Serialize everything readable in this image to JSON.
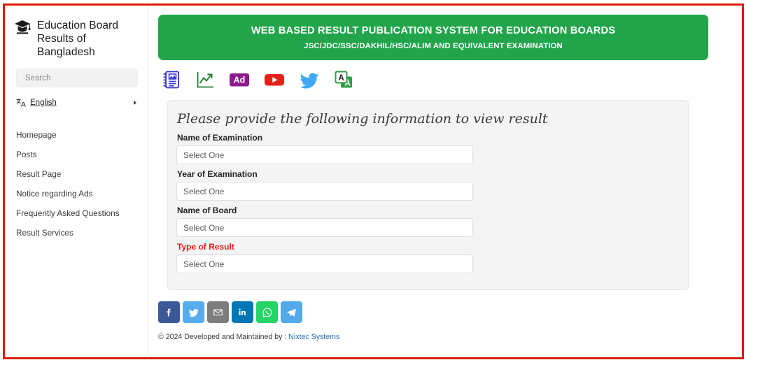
{
  "sidebar": {
    "logo_icon": "graduation-cap-icon",
    "title": "Education Board Results of Bangladesh",
    "search": {
      "placeholder": "Search",
      "value": "",
      "icon": "search-icon"
    },
    "language": {
      "icon": "translate-icon",
      "label": "English",
      "caret": "chevron-right-icon"
    },
    "nav_items": [
      {
        "label": "Homepage"
      },
      {
        "label": "Posts"
      },
      {
        "label": "Result Page"
      },
      {
        "label": "Notice regarding Ads"
      },
      {
        "label": "Frequently Asked Questions"
      },
      {
        "label": "Result Services"
      }
    ]
  },
  "banner": {
    "title": "WEB BASED RESULT PUBLICATION SYSTEM FOR EDUCATION BOARDS",
    "subtitle": "JSC/JDC/SSC/DAKHIL/HSC/ALIM AND EQUIVALENT EXAMINATION",
    "background_color": "#21a44a",
    "text_color": "#ffffff"
  },
  "quick_icons": [
    {
      "name": "result-sheet-icon",
      "color": "#3333cc"
    },
    {
      "name": "statistics-chart-icon",
      "color": "#1f7a33"
    },
    {
      "name": "ad-badge-icon",
      "label": "Ad",
      "color": "#8e1a8e"
    },
    {
      "name": "youtube-icon",
      "color": "#e62117"
    },
    {
      "name": "twitter-icon",
      "color": "#3fa9f5"
    },
    {
      "name": "google-translate-icon",
      "color": "#2e9e44"
    }
  ],
  "form": {
    "heading": "Please provide the following information to view result",
    "fields": [
      {
        "label": "Name of Examination",
        "value": "Select One",
        "required_highlight": false
      },
      {
        "label": "Year of Examination",
        "value": "Select One",
        "required_highlight": false
      },
      {
        "label": "Name of Board",
        "value": "Select One",
        "required_highlight": false
      },
      {
        "label": "Type of Result",
        "value": "Select One",
        "required_highlight": true
      }
    ],
    "danger_color": "#ef1a1a",
    "panel_color": "#f4f4f4"
  },
  "share_buttons": [
    {
      "name": "facebook-share-button",
      "color": "#3b5998",
      "glyph": "f"
    },
    {
      "name": "twitter-share-button",
      "color": "#55acee",
      "glyph": "twitter"
    },
    {
      "name": "email-share-button",
      "color": "#7d7d7d",
      "glyph": "envelope"
    },
    {
      "name": "linkedin-share-button",
      "color": "#0077b5",
      "glyph": "in"
    },
    {
      "name": "whatsapp-share-button",
      "color": "#25d366",
      "glyph": "whatsapp"
    },
    {
      "name": "telegram-share-button",
      "color": "#54a9eb",
      "glyph": "telegram"
    }
  ],
  "footer": {
    "text": "© 2024 Developed and Maintained by : ",
    "link_label": "Nixtec Systems",
    "link_color": "#2a6ebb"
  },
  "frame": {
    "border_color": "#d81f08"
  }
}
